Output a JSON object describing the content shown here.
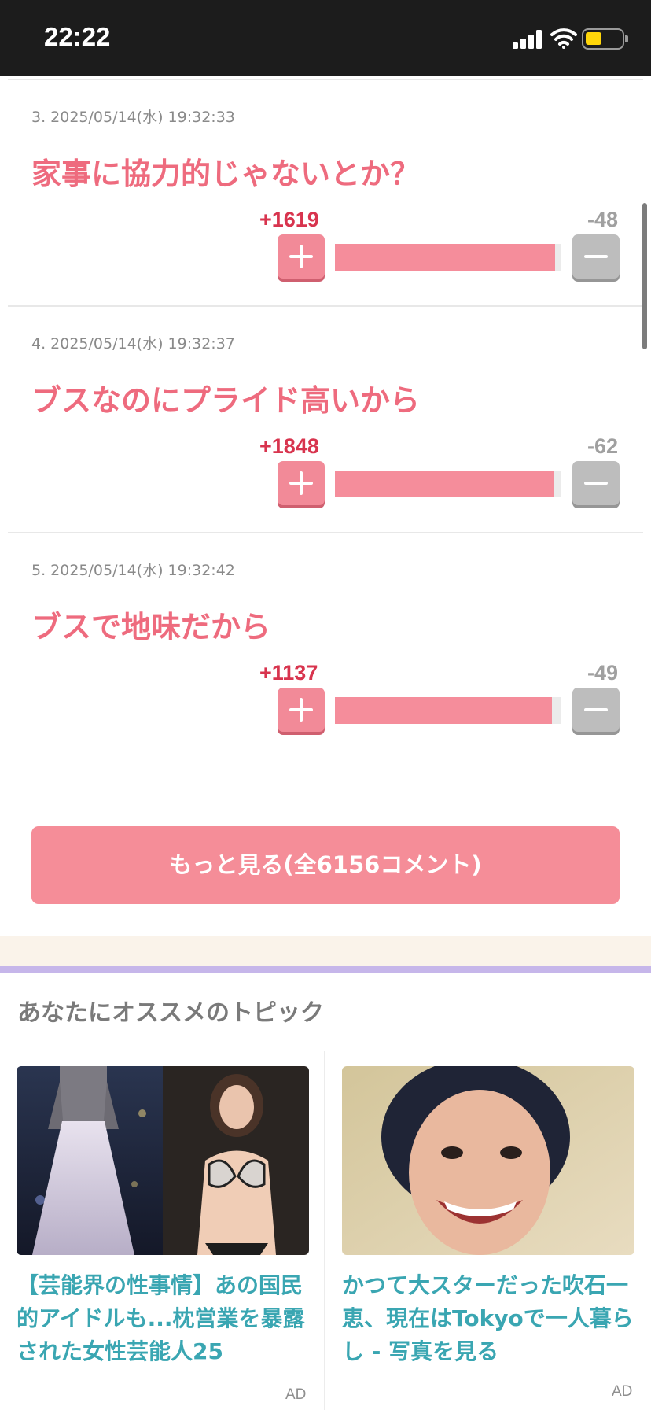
{
  "status_bar": {
    "time": "22:22"
  },
  "comments": [
    {
      "meta": "3. 2025/05/14(水) 19:32:33",
      "body": "家事に協力的じゃないとか？",
      "plus": "+1619",
      "minus": "-48",
      "ratio": 0.971
    },
    {
      "meta": "4. 2025/05/14(水) 19:32:37",
      "body": "ブスなのにプライド高いから",
      "plus": "+1848",
      "minus": "-62",
      "ratio": 0.968
    },
    {
      "meta": "5. 2025/05/14(水) 19:32:42",
      "body": "ブスで地味だから",
      "plus": "+1137",
      "minus": "-49",
      "ratio": 0.959
    }
  ],
  "more_button": {
    "label": "もっと見る(全6156コメント)"
  },
  "recommend": {
    "title": "あなたにオススメのトピック",
    "cards": [
      {
        "text": "【芸能界の性事情】あの国民的アイドルも...枕営業を暴露された女性芸能人25",
        "ad": "AD"
      },
      {
        "text": "かつて大スターだった吹石一恵、現在はTokyoで一人暮らし - 写真を見る",
        "ad": "AD"
      }
    ]
  },
  "colors": {
    "accent": "#f58d98",
    "comment_text": "#ee6b7e",
    "link_text": "#3aa6b2",
    "plus_count": "#d8344e"
  }
}
